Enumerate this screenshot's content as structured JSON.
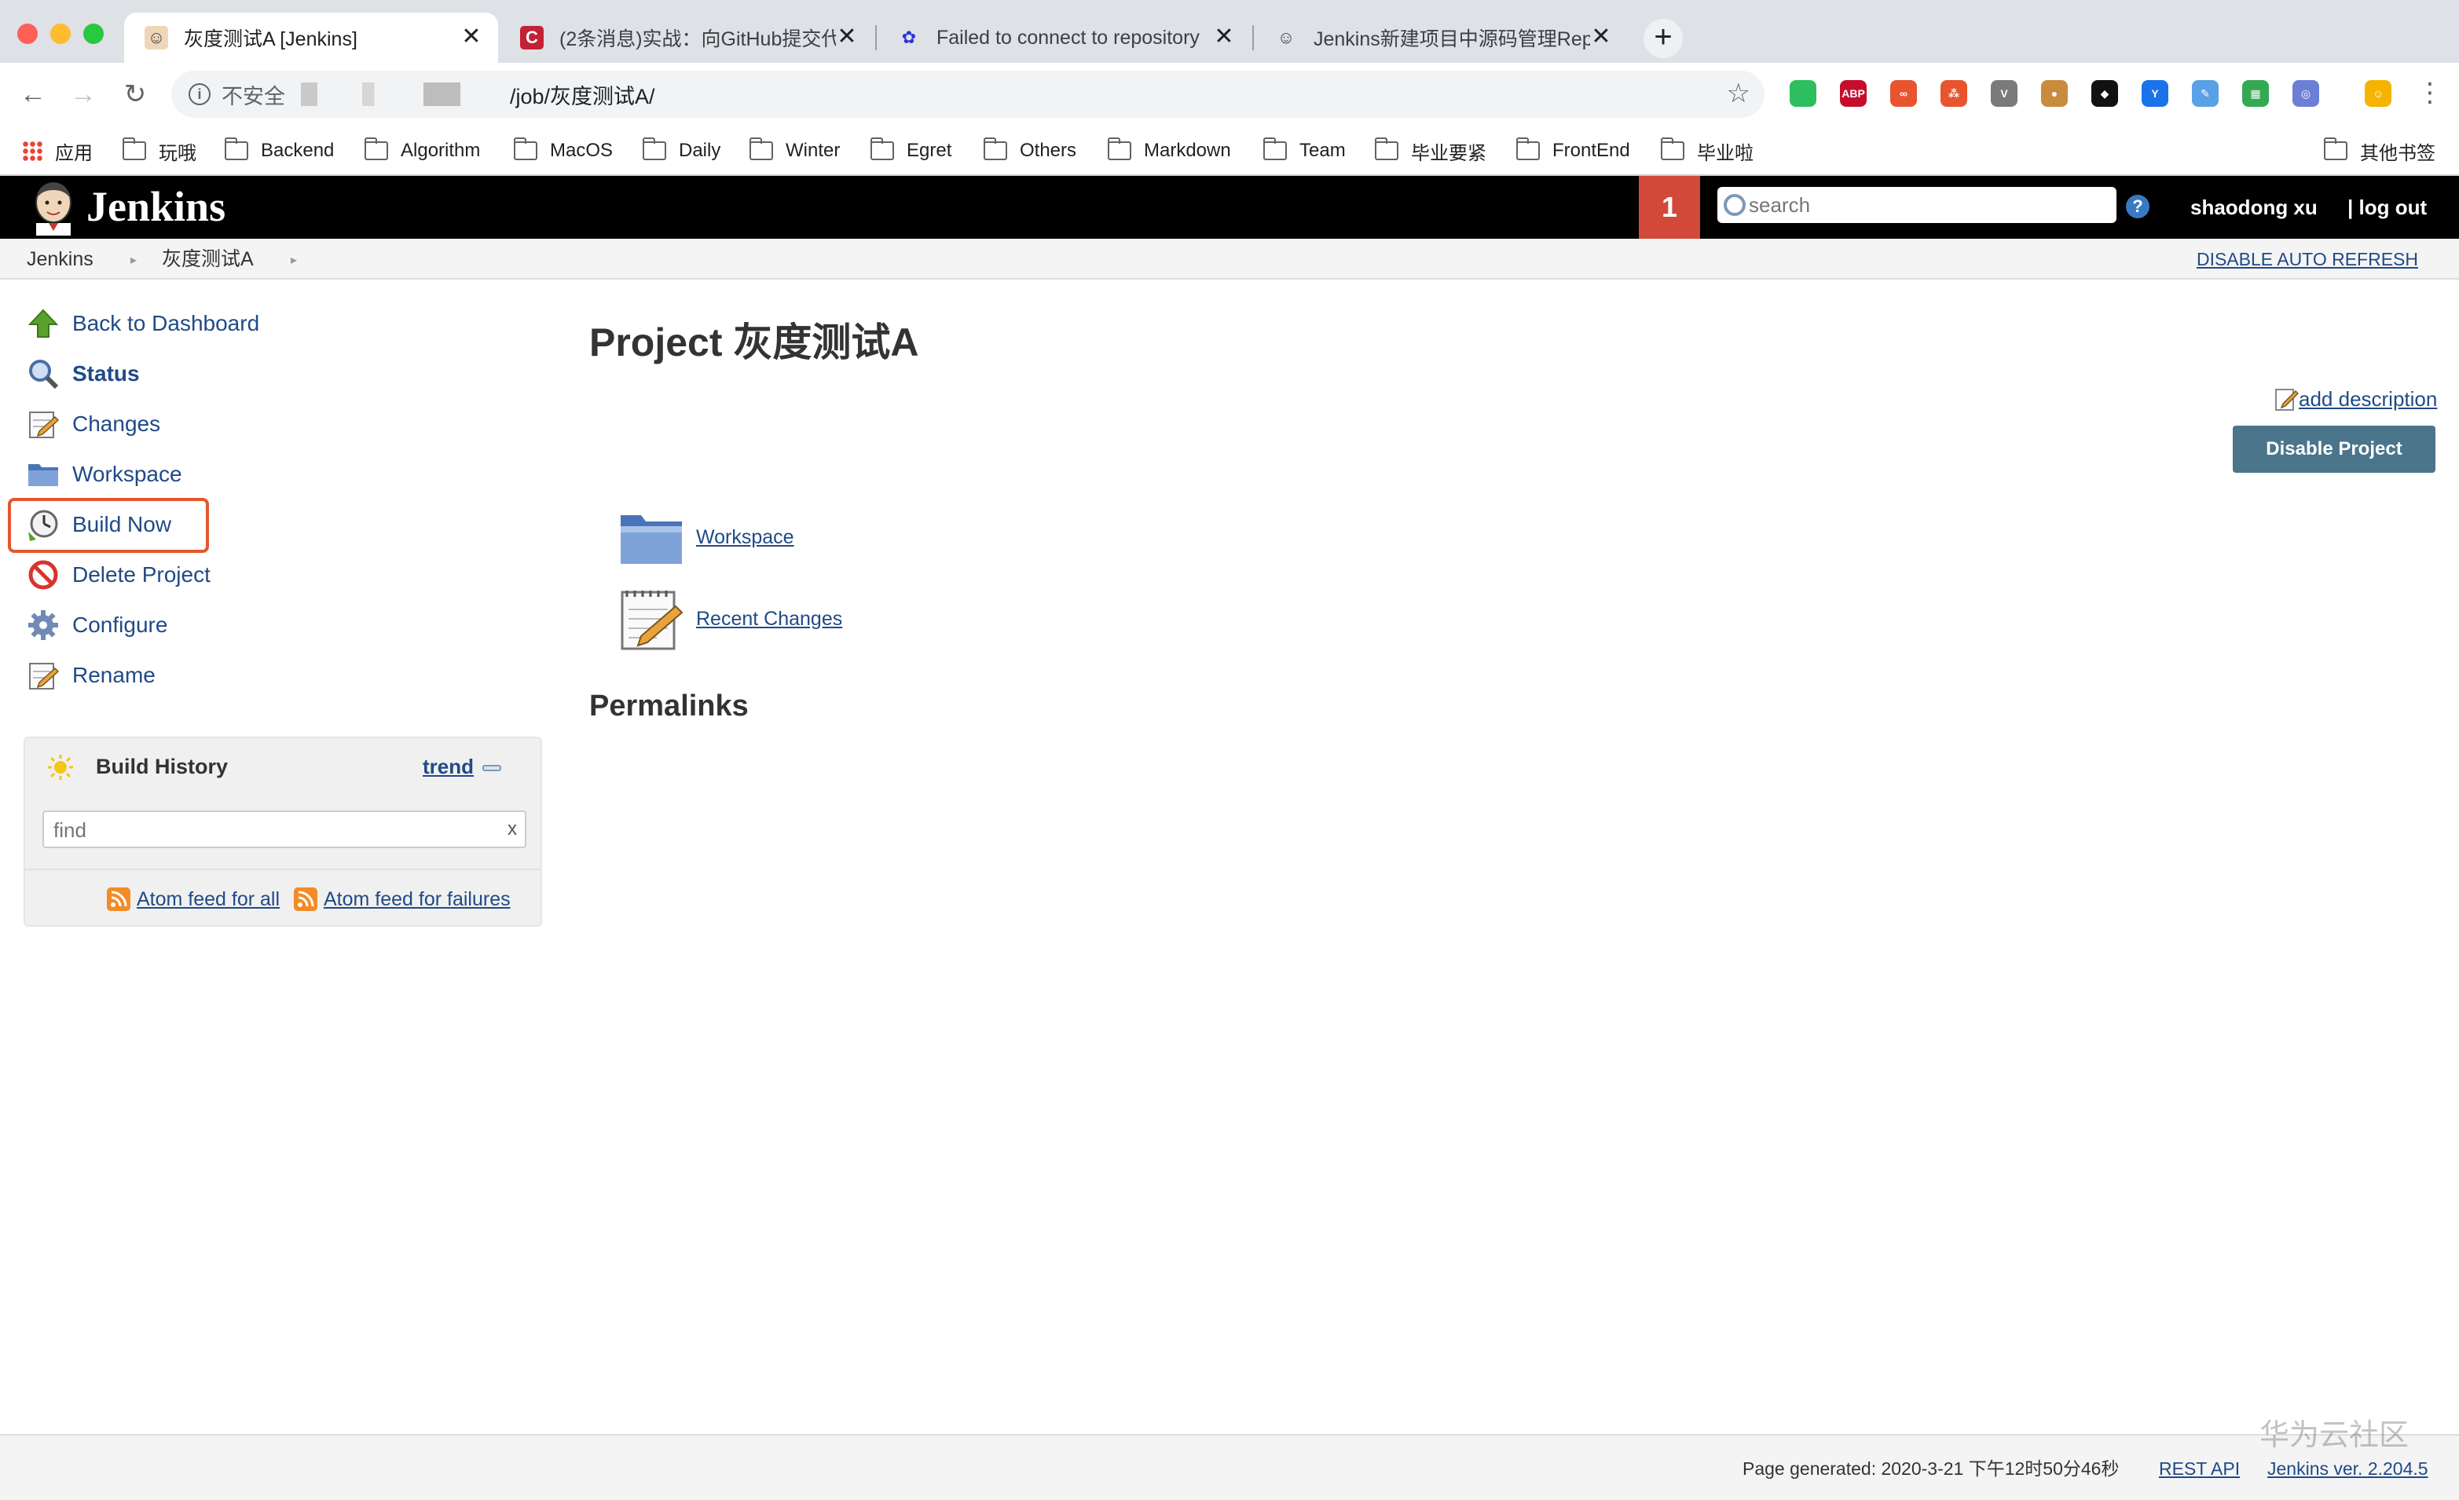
{
  "browser": {
    "tabs": [
      {
        "title": "灰度测试A [Jenkins]",
        "active": true,
        "icon": "jenkins-icon"
      },
      {
        "title": "(2条消息)实战：向GitHub提交代",
        "active": false,
        "icon": "csdn-icon"
      },
      {
        "title": "Failed to connect to repository",
        "active": false,
        "icon": "baidu-icon"
      },
      {
        "title": "Jenkins新建项目中源码管理Rep",
        "active": false,
        "icon": "jenkins-icon"
      }
    ],
    "close_glyph": "✕",
    "new_tab_glyph": "+",
    "address": {
      "security_label": "不安全",
      "url_path": "/job/灰度测试A/"
    },
    "bookmarks": [
      {
        "label": "应用",
        "icon": "apps-icon"
      },
      {
        "label": "玩哦",
        "icon": "folder-icon"
      },
      {
        "label": "Backend",
        "icon": "folder-icon"
      },
      {
        "label": "Algorithm",
        "icon": "folder-icon"
      },
      {
        "label": "MacOS",
        "icon": "folder-icon"
      },
      {
        "label": "Daily",
        "icon": "folder-icon"
      },
      {
        "label": "Winter",
        "icon": "folder-icon"
      },
      {
        "label": "Egret",
        "icon": "folder-icon"
      },
      {
        "label": "Others",
        "icon": "folder-icon"
      },
      {
        "label": "Markdown",
        "icon": "folder-icon"
      },
      {
        "label": "Team",
        "icon": "folder-icon"
      },
      {
        "label": "毕业要紧",
        "icon": "folder-icon"
      },
      {
        "label": "FrontEnd",
        "icon": "folder-icon"
      },
      {
        "label": "毕业啦",
        "icon": "folder-icon"
      }
    ],
    "other_bookmarks": "其他书签",
    "extensions": [
      {
        "name": "evernote-icon",
        "label": "",
        "color": "#2dbe60"
      },
      {
        "name": "adblock-plus-icon",
        "label": "ABP",
        "color": "#c70d2c"
      },
      {
        "name": "infinity-icon",
        "label": "∞",
        "color": "#e8542e"
      },
      {
        "name": "graph-icon",
        "label": "⁂",
        "color": "#e8542e"
      },
      {
        "name": "vue-devtools-icon",
        "label": "V",
        "color": "#7a7a7a"
      },
      {
        "name": "cookie-icon",
        "label": "●",
        "color": "#c98b3c"
      },
      {
        "name": "git-icon",
        "label": "◆",
        "color": "#111111"
      },
      {
        "name": "y-icon",
        "label": "Y",
        "color": "#1a73e8"
      },
      {
        "name": "pen-icon",
        "label": "✎",
        "color": "#5aa0e6"
      },
      {
        "name": "multicolor-icon",
        "label": "▦",
        "color": "#34a853"
      },
      {
        "name": "openai-icon",
        "label": "◎",
        "color": "#6b7fd7"
      },
      {
        "name": "emoji-icon",
        "label": "☺",
        "color": "#f4b400"
      }
    ]
  },
  "jenkins": {
    "brand": "Jenkins",
    "notification_count": "1",
    "search_placeholder": "search",
    "help_glyph": "?",
    "user": "shaodong xu",
    "logout": "| log out",
    "breadcrumb": [
      "Jenkins",
      "灰度测试A"
    ],
    "breadcrumb_arrow": "▸",
    "auto_refresh": "DISABLE AUTO REFRESH",
    "tasks": [
      {
        "label": "Back to Dashboard",
        "icon": "up-arrow-icon",
        "bold": false
      },
      {
        "label": "Status",
        "icon": "magnifier-icon",
        "bold": true
      },
      {
        "label": "Changes",
        "icon": "notepad-icon",
        "bold": false
      },
      {
        "label": "Workspace",
        "icon": "folder-icon",
        "bold": false
      },
      {
        "label": "Build Now",
        "icon": "clock-icon",
        "bold": false
      },
      {
        "label": "Delete Project",
        "icon": "no-entry-icon",
        "bold": false
      },
      {
        "label": "Configure",
        "icon": "gear-icon",
        "bold": false
      },
      {
        "label": "Rename",
        "icon": "notepad-icon",
        "bold": false
      }
    ],
    "build_history": {
      "title": "Build History",
      "trend": "trend",
      "find_placeholder": "find",
      "clear_glyph": "x",
      "feed_all": "Atom feed for all",
      "feed_failures": "Atom feed for failures"
    },
    "project_title": "Project 灰度测试A",
    "add_description": "add description",
    "disable_button": "Disable Project",
    "main_links": [
      {
        "label": "Workspace",
        "icon": "folder-icon"
      },
      {
        "label": "Recent Changes",
        "icon": "notepad-icon"
      }
    ],
    "permalinks_heading": "Permalinks",
    "footer": {
      "generated": "Page generated: 2020-3-21 下午12时50分46秒",
      "rest_api": "REST API",
      "version": "Jenkins ver. 2.204.5"
    },
    "watermark": "华为云社区"
  },
  "colors": {
    "header_bg": "#000000",
    "badge_red": "#d24939",
    "link_blue": "#204a87",
    "button_blue": "#4b758b",
    "highlight": "#e4572e"
  }
}
